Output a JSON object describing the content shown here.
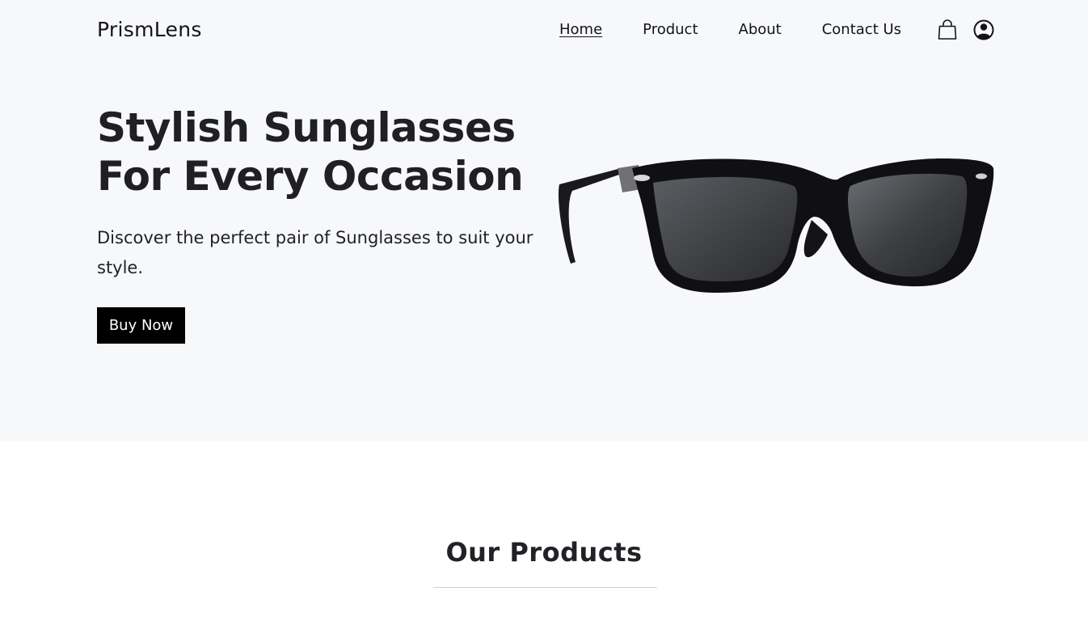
{
  "nav": {
    "brand": "PrismLens",
    "links": [
      {
        "label": "Home",
        "active": true
      },
      {
        "label": "Product",
        "active": false
      },
      {
        "label": "About",
        "active": false
      },
      {
        "label": "Contact Us",
        "active": false
      }
    ],
    "icons": [
      "shopping-bag-icon",
      "user-account-icon"
    ]
  },
  "hero": {
    "title": "Stylish Sunglasses For Every Occasion",
    "subtitle": "Discover the perfect pair of Sunglasses to suit your style.",
    "cta_label": "Buy Now",
    "image": "sunglasses-image"
  },
  "products": {
    "title": "Our Products"
  },
  "colors": {
    "hero_background": "#f7f8fa",
    "button_background": "#000000",
    "button_text": "#ffffff",
    "text": "#1b1b1f"
  }
}
